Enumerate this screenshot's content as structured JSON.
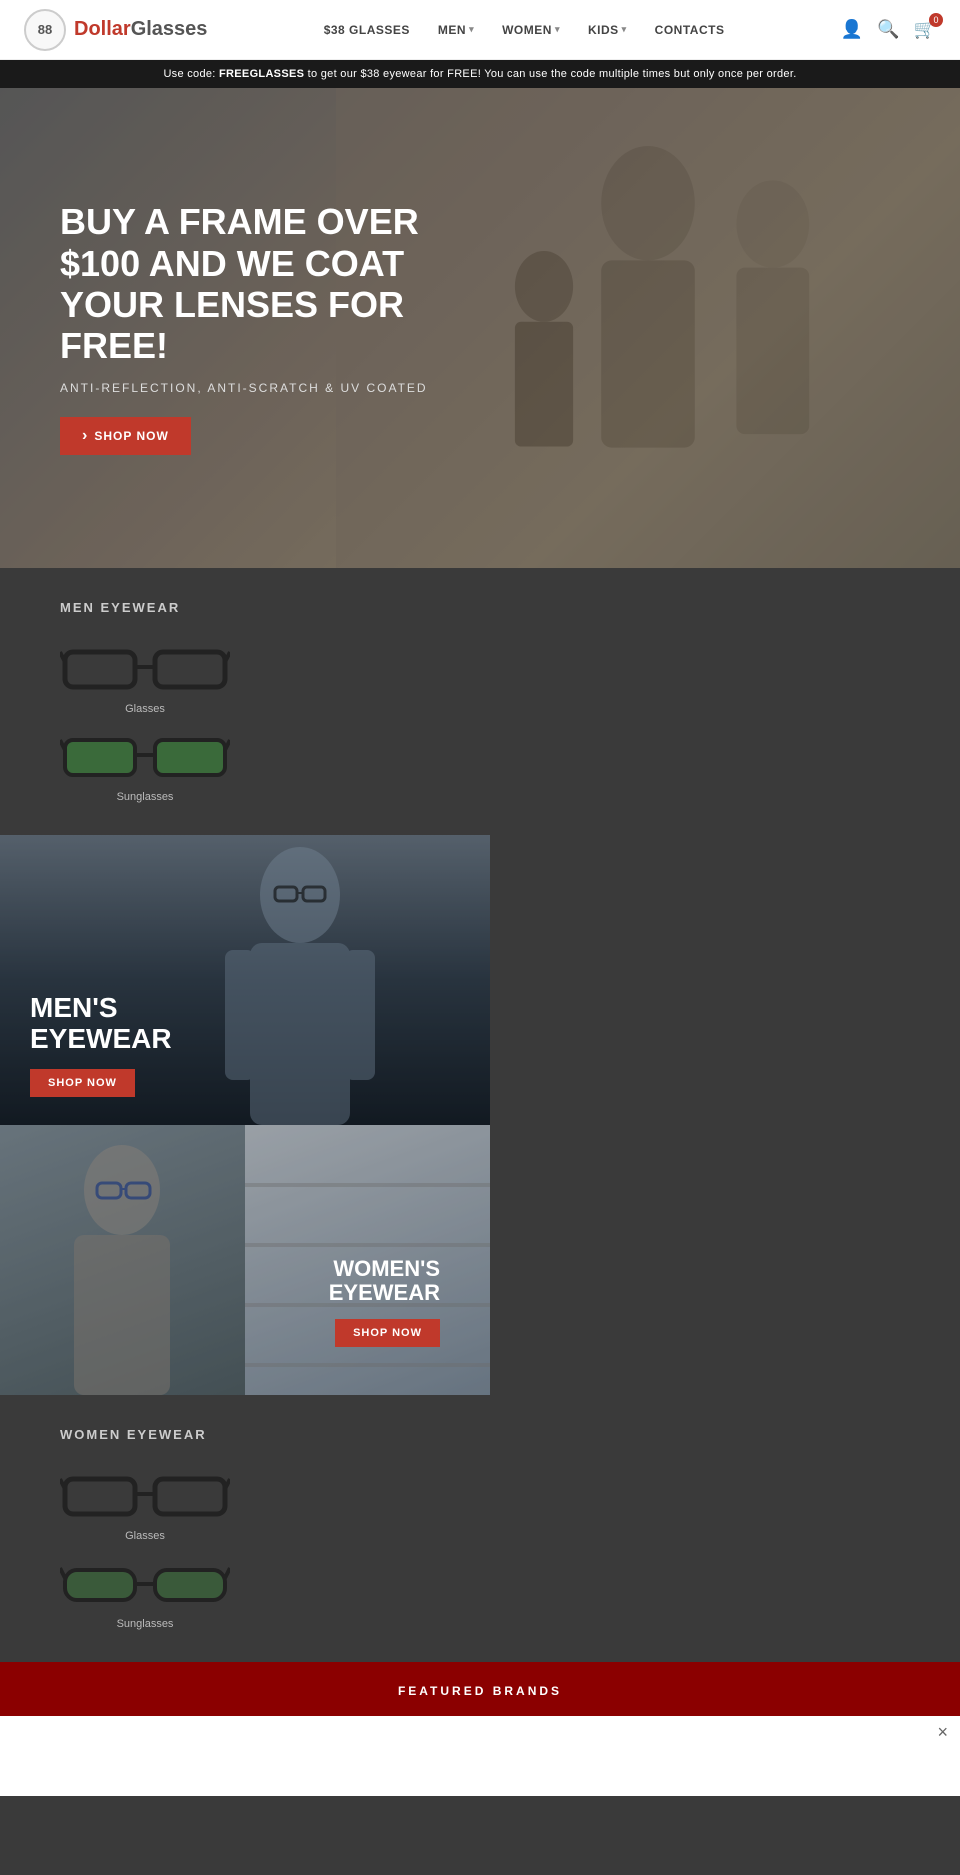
{
  "navbar": {
    "logo_number": "88",
    "logo_brand": "Dollar",
    "logo_product": "Glasses",
    "nav_items": [
      {
        "label": "$38 GLASSES",
        "has_chevron": false
      },
      {
        "label": "MEN",
        "has_chevron": true
      },
      {
        "label": "WOMEN",
        "has_chevron": true
      },
      {
        "label": "KIDS",
        "has_chevron": true
      },
      {
        "label": "CONTACTS",
        "has_chevron": false
      }
    ],
    "cart_count": "0"
  },
  "promo_banner": {
    "prefix": "Use code: ",
    "code": "FREEGLASSES",
    "suffix": " to get our $38 eyewear for FREE! You can use the code multiple times but only once per order."
  },
  "hero": {
    "title": "BUY A FRAME OVER $100 AND WE COAT YOUR LENSES FOR FREE!",
    "subtitle": "ANTI-REFLECTION, ANTI-SCRATCH & UV COATED",
    "button_label": "SHOP NOW"
  },
  "men_eyewear": {
    "section_title": "MEN EYEWEAR",
    "items": [
      {
        "label": "Glasses"
      },
      {
        "label": "Sunglasses"
      }
    ]
  },
  "promo_men": {
    "title_line1": "MEN'S",
    "title_line2": "EYEWEAR",
    "button_label": "SHOP NOW"
  },
  "promo_women": {
    "title_line1": "WOMEN'S",
    "title_line2": "EYEWEAR",
    "button_label": "SHOP NOW"
  },
  "women_eyewear": {
    "section_title": "WOMEN EYEWEAR",
    "items": [
      {
        "label": "Glasses"
      },
      {
        "label": "Sunglasses"
      }
    ]
  },
  "featured_brands": {
    "title": "FEATURED BRANDS",
    "close_label": "×"
  }
}
